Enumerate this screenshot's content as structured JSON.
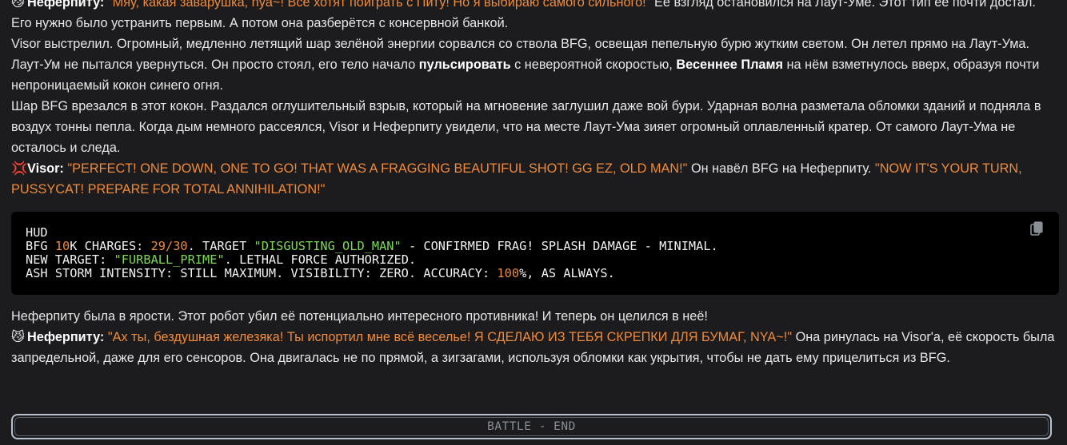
{
  "messages": [
    {
      "emoji": "😼",
      "speaker": "Неферпиту:",
      "quote": "\"Мяу, какая заварушка, nya~! Все хотят поиграть с Питу! Но я выбираю самого сильного!\"",
      "text": " Её взгляд остановился на Лаут-Уме. Этот тип её почти достал. Его нужно было устранить первым. А потом она разберётся с консервной банкой."
    },
    {
      "text": "Visor выстрелил. Огромный, медленно летящий шар зелёной энергии сорвался со ствола BFG, освещая пепельную бурю жутким светом. Он летел прямо на Лаут-Ума."
    },
    {
      "text_a": "Лаут-Ум не пытался увернуться. Он просто стоял, его тело начало ",
      "bold_a": "пульсировать",
      "text_b": " с невероятной скоростью, ",
      "bold_b": "Весеннее Пламя",
      "text_c": " на нём взметнулось вверх, образуя почти непроницаемый кокон синего огня."
    },
    {
      "text": "Шар BFG врезался в этот кокон. Раздался оглушительный взрыв, который на мгновение заглушил даже вой бури. Ударная волна разметала обломки зданий и подняла в воздух тонны пепла. Когда дым немного рассеялся, Visor и Неферпиту увидели, что на месте Лаут-Ума зияет огромный оплавленный кратер. От самого Лаут-Ума не осталось и следа."
    },
    {
      "emoji": "💢",
      "speaker": "Visor:",
      "quote_a": "\"PERFECT! ONE DOWN, ONE TO GO! THAT WAS A FRAGGING BEAUTIFUL SHOT! GG EZ, OLD MAN!\"",
      "text": " Он навёл BFG на Неферпиту. ",
      "quote_b": "\"NOW IT'S YOUR TURN, PUSSYCAT! PREPARE FOR TOTAL ANNIHILATION!\""
    },
    {
      "text": "Неферпиту была в ярости. Этот робот убил её потенциально интересного противника! И теперь он целился в неё!"
    },
    {
      "emoji": "😼",
      "speaker": "Неферпиту:",
      "quote": "\"Ах ты, бездушная железяка! Ты испортил мне всё веселье! Я СДЕЛАЮ ИЗ ТЕБЯ СКРЕПКИ ДЛЯ БУМАГ, NYA~!\"",
      "text": " Она ринулась на Visor'а, её скорость была запредельной, даже для его сенсоров. Она двигалась не по прямой, а зигзагами, используя обломки как укрытия, чтобы не дать ему прицелиться из BFG."
    }
  ],
  "hud": {
    "title": "HUD",
    "l1_a": "BFG ",
    "l1_num1": "10",
    "l1_b": "K CHARGES: ",
    "l1_num2": "29/30",
    "l1_c": ". TARGET ",
    "l1_str": "\"DISGUSTING_OLD_MAN\"",
    "l1_d": " - CONFIRMED FRAG! SPLASH DAMAGE - MINIMAL.",
    "l2_a": "NEW TARGET: ",
    "l2_str": "\"FURBALL_PRIME\"",
    "l2_b": ". LETHAL FORCE AUTHORIZED.",
    "l3_a": "ASH STORM INTENSITY: STILL MAXIMUM. VISIBILITY: ZERO. ACCURACY: ",
    "l3_num": "100",
    "l3_b": "%, AS ALWAYS."
  },
  "copy_icon": "copy-icon",
  "end_bar": {
    "label": "BATTLE - END"
  },
  "colors": {
    "background": "#1c1c1e",
    "quote": "#f08a3c",
    "code_string": "#7ed957",
    "code_number": "#f08a3c"
  }
}
